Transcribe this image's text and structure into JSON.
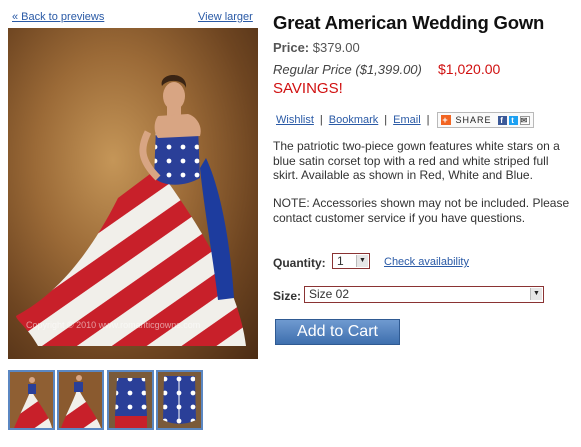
{
  "nav": {
    "back_label": "« Back to previews",
    "view_larger_label": "View larger"
  },
  "product": {
    "title": "Great American Wedding Gown",
    "price_label": "Price:",
    "price": "$379.00",
    "regular_price": "Regular Price ($1,399.00)",
    "sale_price": "$1,020.00",
    "savings": "SAVINGS!",
    "description": "The patriotic two-piece gown features white stars on a blue satin corset top with a red and white striped full skirt. Available as shown in Red, White and Blue.",
    "note": "NOTE: Accessories shown may not be included. Please contact customer service if you have questions."
  },
  "actions": {
    "wishlist": "Wishlist",
    "bookmark": "Bookmark",
    "email": "Email",
    "separator": "|",
    "share": "SHARE"
  },
  "form": {
    "quantity_label": "Quantity:",
    "quantity_value": "1",
    "check_availability": "Check availability",
    "size_label": "Size:",
    "size_value": "Size 02",
    "add_to_cart": "Add to Cart"
  },
  "image": {
    "watermark": "Copyright © 2010 www.romanticgowns.com"
  },
  "colors": {
    "link": "#2a5aa6",
    "sale_red": "#d01010",
    "button_blue": "#4f7fbd",
    "thumb_border": "#5b87c2"
  },
  "icons": [
    "share-plus-icon",
    "facebook-icon",
    "twitter-icon",
    "email-icon",
    "dropdown-arrow-icon"
  ]
}
